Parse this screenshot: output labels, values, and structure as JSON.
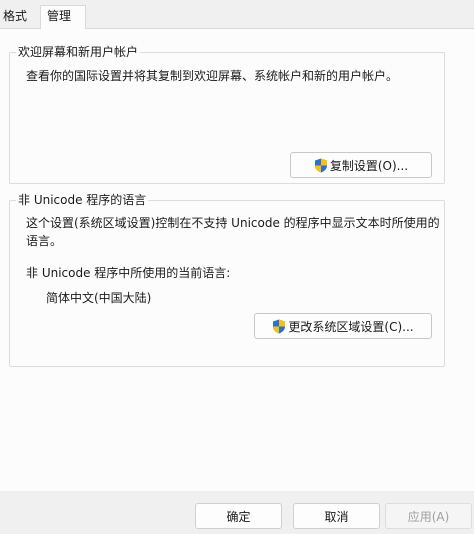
{
  "tabs": [
    {
      "label": "格式"
    },
    {
      "label": "管理"
    }
  ],
  "welcome_group": {
    "title": "欢迎屏幕和新用户帐户",
    "description": "查看你的国际设置并将其复制到欢迎屏幕、系统帐户和新的用户帐户。",
    "copy_button": "复制设置(O)..."
  },
  "unicode_group": {
    "title": "非 Unicode 程序的语言",
    "description_line1": "这个设置(系统区域设置)控制在不支持 Unicode 的程序中显示文本时所使用的",
    "description_line2": "语言。",
    "current_label": "非 Unicode 程序中所使用的当前语言:",
    "current_value": "简体中文(中国大陆)",
    "change_button": "更改系统区域设置(C)..."
  },
  "footer": {
    "ok": "确定",
    "cancel": "取消",
    "apply": "应用(A)"
  },
  "colors": {
    "accent": "#3b6fb6",
    "shield_blue": "#2f6fd1",
    "shield_yellow": "#f3c31a"
  },
  "icons": {
    "uac": "uac-shield-icon"
  }
}
